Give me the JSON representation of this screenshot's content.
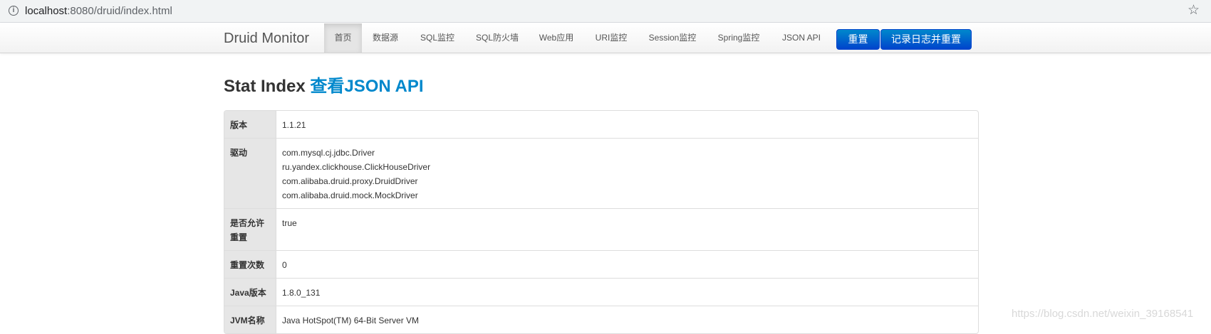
{
  "browser": {
    "info_icon": "info-icon",
    "url_host": "localhost",
    "url_path": ":8080/druid/index.html",
    "star_icon": "star-icon"
  },
  "navbar": {
    "brand": "Druid Monitor",
    "items": [
      {
        "label": "首页",
        "active": true
      },
      {
        "label": "数据源"
      },
      {
        "label": "SQL监控"
      },
      {
        "label": "SQL防火墙"
      },
      {
        "label": "Web应用"
      },
      {
        "label": "URI监控"
      },
      {
        "label": "Session监控"
      },
      {
        "label": "Spring监控"
      },
      {
        "label": "JSON API"
      }
    ],
    "reset_label": "重置",
    "log_reset_label": "记录日志并重置",
    "accent_color": "#0055cc"
  },
  "page": {
    "title": "Stat Index",
    "title_link": "查看JSON API"
  },
  "stats": {
    "version_key": "版本",
    "version": "1.1.21",
    "drivers_key": "驱动",
    "drivers": [
      "com.mysql.cj.jdbc.Driver",
      "ru.yandex.clickhouse.ClickHouseDriver",
      "com.alibaba.druid.proxy.DruidDriver",
      "com.alibaba.druid.mock.MockDriver"
    ],
    "reset_enable_key": "是否允许重置",
    "reset_enable": "true",
    "reset_count_key": "重置次数",
    "reset_count": "0",
    "java_version_key": "Java版本",
    "java_version": "1.8.0_131",
    "jvm_name_key": "JVM名称",
    "jvm_name": "Java HotSpot(TM) 64-Bit Server VM"
  },
  "watermark": "https://blog.csdn.net/weixin_39168541"
}
